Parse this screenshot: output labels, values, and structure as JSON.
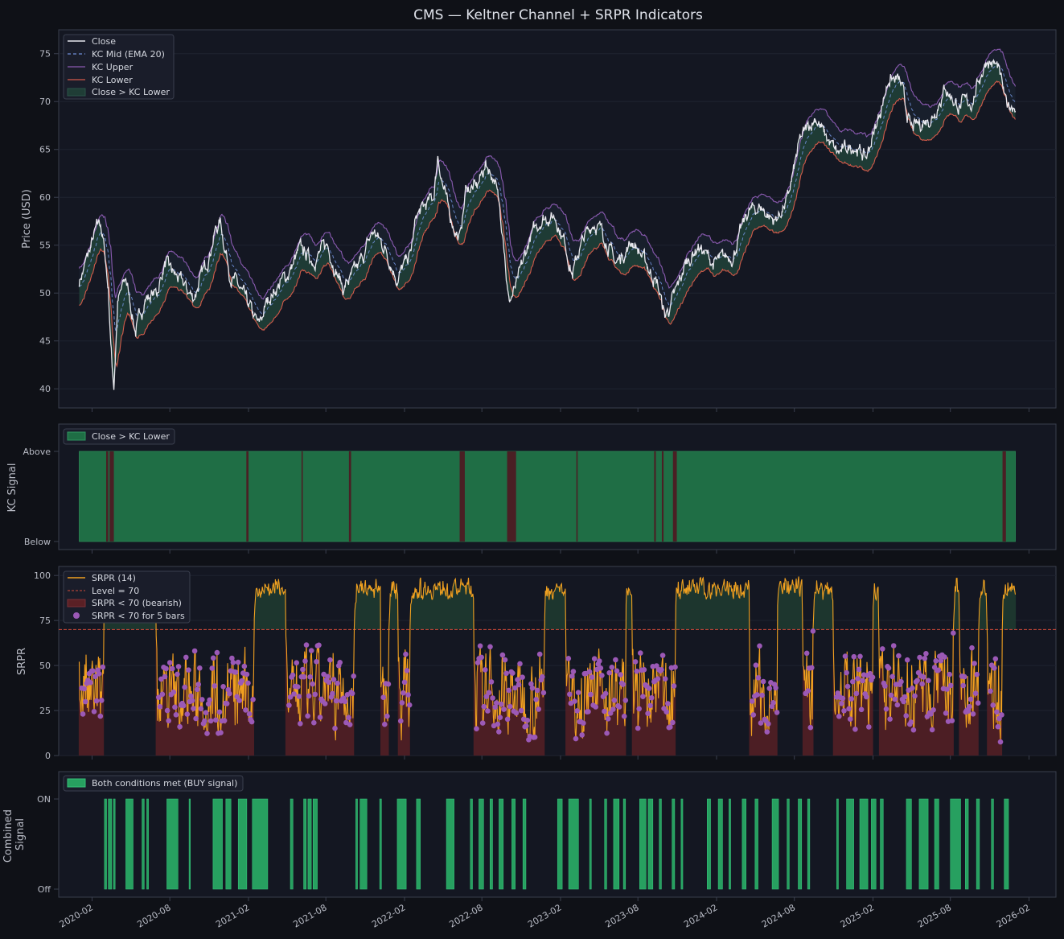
{
  "title": "CMS — Keltner Channel + SRPR Indicators",
  "colors": {
    "background": "#0f1117",
    "panel": "#141722",
    "axis": "#3a3f4e",
    "close": "#e8e8ee",
    "kc_mid": "#6f8fd6",
    "kc_upper": "#8a5ab0",
    "kc_lower": "#d25a4a",
    "fill_above": "#1f3d36",
    "fill_upper": "#181f2c",
    "signal_above": "#1f6e45",
    "signal_below": "#4a1f24",
    "srpr": "#f0a020",
    "level": "#d04a3a",
    "bearish": "#5a2025",
    "dot": "#9b59b6",
    "buy": "#27a060"
  },
  "chart_data": [
    {
      "id": "price",
      "type": "line",
      "title": "",
      "ylabel": "Price (USD)",
      "ylim": [
        38.0,
        77.5
      ],
      "yticks": [
        40,
        45,
        50,
        55,
        60,
        65,
        70,
        75
      ],
      "legend": [
        "Close",
        "KC Mid (EMA 20)",
        "KC Upper",
        "KC Lower",
        "Close > KC Lower"
      ],
      "legend_loc": "upper-left",
      "x_range": [
        "2019-11-15",
        "2026-04-05"
      ],
      "data_range": [
        "2020-01-02",
        "2025-12-31"
      ],
      "close_anchors": [
        [
          "2020-01-02",
          51.2
        ],
        [
          "2020-01-20",
          53.5
        ],
        [
          "2020-02-10",
          56.5
        ],
        [
          "2020-02-21",
          57.4
        ],
        [
          "2020-03-02",
          54.0
        ],
        [
          "2020-03-10",
          50.5
        ],
        [
          "2020-03-18",
          43.0
        ],
        [
          "2020-03-23",
          40.3
        ],
        [
          "2020-04-01",
          49.0
        ],
        [
          "2020-04-20",
          51.5
        ],
        [
          "2020-05-13",
          46.0
        ],
        [
          "2020-06-05",
          49.5
        ],
        [
          "2020-07-01",
          50.0
        ],
        [
          "2020-07-20",
          53.0
        ],
        [
          "2020-08-20",
          51.5
        ],
        [
          "2020-09-25",
          49.5
        ],
        [
          "2020-10-25",
          53.0
        ],
        [
          "2020-11-15",
          56.5
        ],
        [
          "2020-11-27",
          57.5
        ],
        [
          "2020-12-20",
          52.0
        ],
        [
          "2021-01-10",
          50.5
        ],
        [
          "2021-02-25",
          46.5
        ],
        [
          "2021-03-20",
          49.5
        ],
        [
          "2021-05-05",
          52.0
        ],
        [
          "2021-06-01",
          54.5
        ],
        [
          "2021-07-01",
          53.5
        ],
        [
          "2021-08-05",
          55.0
        ],
        [
          "2021-09-10",
          50.5
        ],
        [
          "2021-10-15",
          52.5
        ],
        [
          "2021-11-20",
          56.5
        ],
        [
          "2021-12-20",
          54.5
        ],
        [
          "2022-01-15",
          51.5
        ],
        [
          "2022-02-15",
          54.0
        ],
        [
          "2022-03-01",
          58.0
        ],
        [
          "2022-04-10",
          60.0
        ],
        [
          "2022-04-20",
          64.5
        ],
        [
          "2022-05-01",
          61.5
        ],
        [
          "2022-05-15",
          58.5
        ],
        [
          "2022-06-10",
          55.5
        ],
        [
          "2022-06-25",
          61.0
        ],
        [
          "2022-07-20",
          61.0
        ],
        [
          "2022-08-10",
          63.5
        ],
        [
          "2022-08-30",
          62.0
        ],
        [
          "2022-09-20",
          56.5
        ],
        [
          "2022-10-02",
          49.0
        ],
        [
          "2022-10-20",
          50.5
        ],
        [
          "2022-11-20",
          55.5
        ],
        [
          "2022-12-20",
          58.0
        ],
        [
          "2023-01-20",
          58.0
        ],
        [
          "2023-02-10",
          55.5
        ],
        [
          "2023-03-01",
          52.0
        ],
        [
          "2023-03-20",
          55.0
        ],
        [
          "2023-04-20",
          57.5
        ],
        [
          "2023-05-15",
          56.0
        ],
        [
          "2023-06-10",
          53.0
        ],
        [
          "2023-07-20",
          55.5
        ],
        [
          "2023-08-15",
          53.5
        ],
        [
          "2023-09-15",
          51.0
        ],
        [
          "2023-10-03",
          47.5
        ],
        [
          "2023-10-25",
          49.5
        ],
        [
          "2023-11-20",
          53.0
        ],
        [
          "2023-12-20",
          55.0
        ],
        [
          "2024-01-25",
          53.0
        ],
        [
          "2024-03-10",
          54.0
        ],
        [
          "2024-04-15",
          58.5
        ],
        [
          "2024-05-15",
          59.0
        ],
        [
          "2024-06-15",
          57.5
        ],
        [
          "2024-07-15",
          59.5
        ],
        [
          "2024-08-15",
          66.0
        ],
        [
          "2024-09-20",
          68.5
        ],
        [
          "2024-10-10",
          66.5
        ],
        [
          "2024-11-10",
          64.5
        ],
        [
          "2024-12-20",
          65.5
        ],
        [
          "2025-01-15",
          64.0
        ],
        [
          "2025-02-15",
          68.5
        ],
        [
          "2025-03-10",
          72.5
        ],
        [
          "2025-04-05",
          72.0
        ],
        [
          "2025-05-01",
          67.0
        ],
        [
          "2025-06-01",
          68.0
        ],
        [
          "2025-06-20",
          68.5
        ],
        [
          "2025-07-20",
          71.5
        ],
        [
          "2025-08-20",
          69.5
        ],
        [
          "2025-09-20",
          70.0
        ],
        [
          "2025-10-25",
          74.5
        ],
        [
          "2025-11-20",
          73.5
        ],
        [
          "2025-12-10",
          69.5
        ],
        [
          "2025-12-31",
          69.8
        ]
      ]
    },
    {
      "id": "kc_signal",
      "type": "area",
      "ylabel": "KC Signal",
      "yticks": [
        "Below",
        "Above"
      ],
      "legend": [
        "Close > KC Lower"
      ],
      "legend_loc": "upper-left",
      "below_periods": [
        [
          "2020-03-05",
          "2020-03-10"
        ],
        [
          "2020-03-13",
          "2020-03-23"
        ],
        [
          "2021-01-27",
          "2021-02-01"
        ],
        [
          "2021-06-05",
          "2021-06-08"
        ],
        [
          "2021-09-24",
          "2021-09-29"
        ],
        [
          "2022-06-10",
          "2022-06-22"
        ],
        [
          "2022-09-29",
          "2022-10-20"
        ],
        [
          "2023-03-10",
          "2023-03-13"
        ],
        [
          "2023-09-08",
          "2023-09-12"
        ],
        [
          "2023-09-26",
          "2023-09-30"
        ],
        [
          "2023-10-22",
          "2023-10-31"
        ],
        [
          "2025-12-01",
          "2025-12-09"
        ]
      ]
    },
    {
      "id": "srpr",
      "type": "line",
      "ylabel": "SRPR",
      "ylim": [
        0,
        105
      ],
      "yticks": [
        0,
        25,
        50,
        75,
        100
      ],
      "level": 70,
      "legend": [
        "SRPR (14)",
        "Level = 70",
        "SRPR < 70 (bearish)",
        "SRPR < 70 for 5 bars"
      ],
      "legend_loc": "upper-left",
      "n_points": 1509
    },
    {
      "id": "combined",
      "type": "area",
      "ylabel": "Combined\nSignal",
      "yticks": [
        "Off",
        "ON"
      ],
      "legend": [
        "Both conditions met (BUY signal)"
      ],
      "legend_loc": "upper-left",
      "on_periods": [
        [
          "2020-03-01",
          "2020-03-06"
        ],
        [
          "2020-03-10",
          "2020-03-18"
        ],
        [
          "2020-03-22",
          "2020-03-26"
        ],
        [
          "2020-04-20",
          "2020-05-07"
        ],
        [
          "2020-05-28",
          "2020-06-02"
        ],
        [
          "2020-06-08",
          "2020-06-12"
        ],
        [
          "2020-07-25",
          "2020-08-20"
        ],
        [
          "2020-09-15",
          "2020-09-18"
        ],
        [
          "2020-11-10",
          "2020-12-02"
        ],
        [
          "2020-12-10",
          "2020-12-22"
        ],
        [
          "2021-01-08",
          "2021-01-28"
        ],
        [
          "2021-02-10",
          "2021-03-18"
        ],
        [
          "2021-05-10",
          "2021-05-16"
        ],
        [
          "2021-06-10",
          "2021-06-16"
        ],
        [
          "2021-06-20",
          "2021-06-28"
        ],
        [
          "2021-07-02",
          "2021-07-12"
        ],
        [
          "2021-10-10",
          "2021-10-14"
        ],
        [
          "2021-10-20",
          "2021-11-05"
        ],
        [
          "2021-12-05",
          "2021-12-09"
        ],
        [
          "2022-01-15",
          "2022-02-05"
        ],
        [
          "2022-03-01",
          "2022-03-10"
        ],
        [
          "2022-05-10",
          "2022-05-28"
        ],
        [
          "2022-07-05",
          "2022-07-10"
        ],
        [
          "2022-07-25",
          "2022-08-05"
        ],
        [
          "2022-08-20",
          "2022-08-26"
        ],
        [
          "2022-09-10",
          "2022-09-20"
        ],
        [
          "2022-10-10",
          "2022-10-18"
        ],
        [
          "2022-11-05",
          "2022-11-12"
        ],
        [
          "2023-01-25",
          "2023-02-05"
        ],
        [
          "2023-02-20",
          "2023-03-15"
        ],
        [
          "2023-04-10",
          "2023-04-14"
        ],
        [
          "2023-05-15",
          "2023-05-20"
        ],
        [
          "2023-06-05",
          "2023-06-18"
        ],
        [
          "2023-06-28",
          "2023-07-03"
        ],
        [
          "2023-08-05",
          "2023-08-20"
        ],
        [
          "2023-08-25",
          "2023-09-05"
        ],
        [
          "2023-09-20",
          "2023-09-25"
        ],
        [
          "2023-10-20",
          "2023-10-26"
        ],
        [
          "2023-11-10",
          "2023-11-14"
        ],
        [
          "2024-01-10",
          "2024-01-18"
        ],
        [
          "2024-02-05",
          "2024-02-15"
        ],
        [
          "2024-03-01",
          "2024-03-05"
        ],
        [
          "2024-04-01",
          "2024-04-10"
        ],
        [
          "2024-05-01",
          "2024-05-08"
        ],
        [
          "2024-06-10",
          "2024-06-25"
        ],
        [
          "2024-07-15",
          "2024-07-20"
        ],
        [
          "2024-08-10",
          "2024-08-18"
        ],
        [
          "2024-09-01",
          "2024-09-06"
        ],
        [
          "2024-11-08",
          "2024-11-12"
        ],
        [
          "2024-12-01",
          "2024-12-18"
        ],
        [
          "2025-01-01",
          "2025-01-20"
        ],
        [
          "2025-01-28",
          "2025-02-08"
        ],
        [
          "2025-02-18",
          "2025-02-25"
        ],
        [
          "2025-04-20",
          "2025-05-02"
        ],
        [
          "2025-05-20",
          "2025-06-10"
        ],
        [
          "2025-06-25",
          "2025-07-05"
        ],
        [
          "2025-08-01",
          "2025-08-25"
        ],
        [
          "2025-09-05",
          "2025-09-12"
        ],
        [
          "2025-10-01",
          "2025-10-08"
        ],
        [
          "2025-11-05",
          "2025-11-10"
        ],
        [
          "2025-12-05",
          "2025-12-15"
        ]
      ]
    }
  ],
  "xticks": [
    "2020-02",
    "2020-08",
    "2021-02",
    "2021-08",
    "2022-02",
    "2022-08",
    "2023-02",
    "2023-08",
    "2024-02",
    "2024-08",
    "2025-02",
    "2025-08",
    "2026-02"
  ]
}
